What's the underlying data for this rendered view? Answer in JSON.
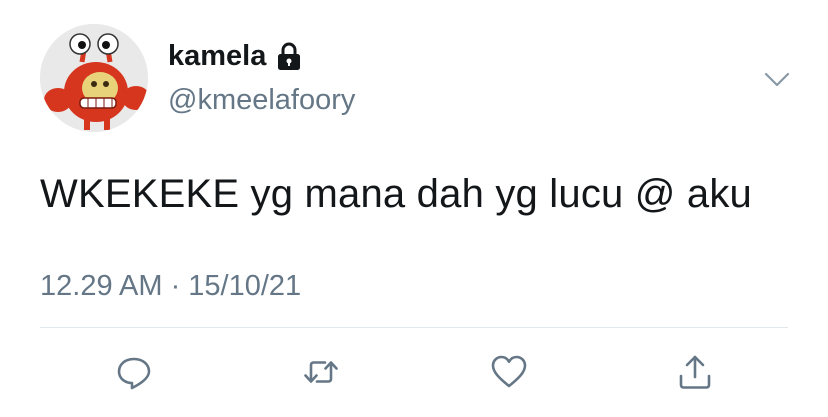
{
  "tweet": {
    "display_name": "kamela",
    "handle": "@kmeelafoory",
    "text": "WKEKEKE yg mana dah yg lucu @ aku",
    "timestamp": "12.29 AM · 15/10/21",
    "protected": true
  },
  "icons": {
    "avatar": "avatar-image",
    "lock": "lock-icon",
    "more": "chevron-down-icon",
    "reply": "reply-icon",
    "retweet": "retweet-icon",
    "like": "heart-icon",
    "share": "share-icon"
  },
  "colors": {
    "text_primary": "#14171a",
    "text_secondary": "#657786",
    "icon": "#657786",
    "divider": "#e1e8ed",
    "background": "#ffffff"
  }
}
